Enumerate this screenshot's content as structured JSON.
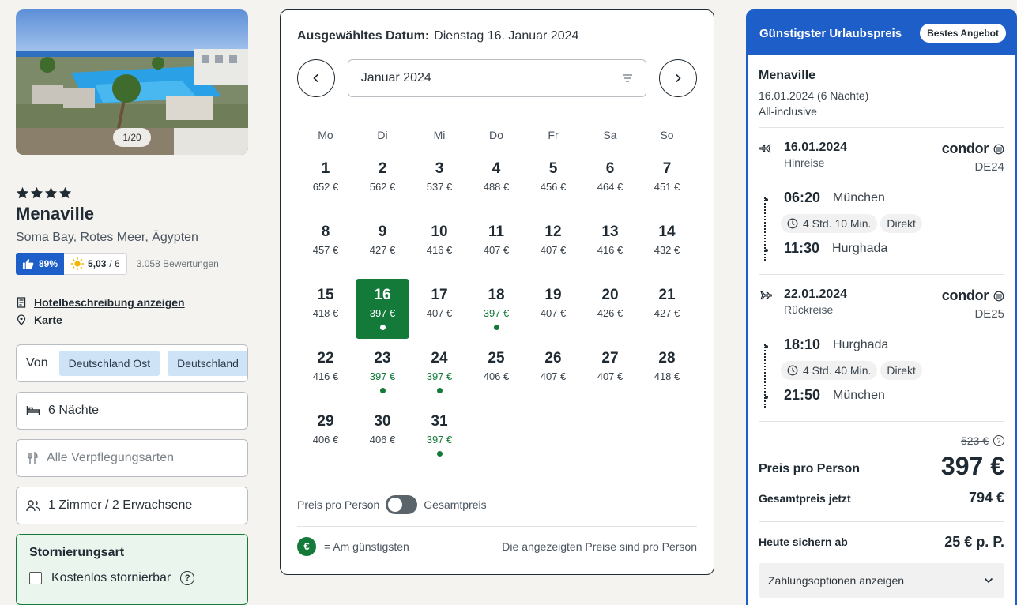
{
  "gallery": {
    "counter": "1/20"
  },
  "hotel": {
    "stars": 4,
    "name": "Menaville",
    "location": "Soma Bay, Rotes Meer, Ägypten",
    "recommendation": "89%",
    "score": "5,03",
    "score_max": "/ 6",
    "review_count": "3.058 Bewertungen",
    "description_link": "Hotelbeschreibung anzeigen",
    "map_link": "Karte"
  },
  "filters": {
    "departure_label": "Von",
    "departure_chips": [
      "Deutschland Ost",
      "Deutschland"
    ],
    "duration": "6 Nächte",
    "board_placeholder": "Alle Verpflegungsarten",
    "rooms": "1 Zimmer / 2 Erwachsene",
    "cancellation_title": "Stornierungsart",
    "cancellation_option": "Kostenlos stornierbar",
    "help_glyph": "?"
  },
  "calendar": {
    "selected_label": "Ausgewähltes Datum:",
    "selected_value": "Dienstag 16. Januar 2024",
    "month": "Januar 2024",
    "weekdays": [
      "Mo",
      "Di",
      "Mi",
      "Do",
      "Fr",
      "Sa",
      "So"
    ],
    "days": [
      {
        "day": "1",
        "price": "652 €",
        "cheap": false
      },
      {
        "day": "2",
        "price": "562 €",
        "cheap": false
      },
      {
        "day": "3",
        "price": "537 €",
        "cheap": false
      },
      {
        "day": "4",
        "price": "488 €",
        "cheap": false
      },
      {
        "day": "5",
        "price": "456 €",
        "cheap": false
      },
      {
        "day": "6",
        "price": "464 €",
        "cheap": false
      },
      {
        "day": "7",
        "price": "451 €",
        "cheap": false
      },
      {
        "day": "8",
        "price": "457 €",
        "cheap": false
      },
      {
        "day": "9",
        "price": "427 €",
        "cheap": false
      },
      {
        "day": "10",
        "price": "416 €",
        "cheap": false
      },
      {
        "day": "11",
        "price": "407 €",
        "cheap": false
      },
      {
        "day": "12",
        "price": "407 €",
        "cheap": false
      },
      {
        "day": "13",
        "price": "416 €",
        "cheap": false
      },
      {
        "day": "14",
        "price": "432 €",
        "cheap": false
      },
      {
        "day": "15",
        "price": "418 €",
        "cheap": false
      },
      {
        "day": "16",
        "price": "397 €",
        "cheap": true,
        "selected": true
      },
      {
        "day": "17",
        "price": "407 €",
        "cheap": false
      },
      {
        "day": "18",
        "price": "397 €",
        "cheap": true
      },
      {
        "day": "19",
        "price": "407 €",
        "cheap": false
      },
      {
        "day": "20",
        "price": "426 €",
        "cheap": false
      },
      {
        "day": "21",
        "price": "427 €",
        "cheap": false
      },
      {
        "day": "22",
        "price": "416 €",
        "cheap": false
      },
      {
        "day": "23",
        "price": "397 €",
        "cheap": true
      },
      {
        "day": "24",
        "price": "397 €",
        "cheap": true
      },
      {
        "day": "25",
        "price": "406 €",
        "cheap": false
      },
      {
        "day": "26",
        "price": "407 €",
        "cheap": false
      },
      {
        "day": "27",
        "price": "407 €",
        "cheap": false
      },
      {
        "day": "28",
        "price": "418 €",
        "cheap": false
      },
      {
        "day": "29",
        "price": "406 €",
        "cheap": false
      },
      {
        "day": "30",
        "price": "406 €",
        "cheap": false
      },
      {
        "day": "31",
        "price": "397 €",
        "cheap": true
      }
    ],
    "toggle_left": "Preis pro Person",
    "toggle_right": "Gesamtpreis",
    "legend_symbol": "€",
    "legend_text": "= Am günstigsten",
    "footnote": "Die angezeigten Preise sind pro Person",
    "accent_color": "#137a3a"
  },
  "offer": {
    "header_title": "Günstigster Urlaubspreis",
    "badge": "Bestes Angebot",
    "hotel_name": "Menaville",
    "dates": "16.01.2024 (6 Nächte)",
    "board": "All-inclusive",
    "outbound": {
      "date": "16.01.2024",
      "direction": "Hinreise",
      "airline": "condor",
      "flight_no": "DE24",
      "dep_time": "06:20",
      "dep_place": "München",
      "duration": "4 Std. 10 Min.",
      "type": "Direkt",
      "arr_time": "11:30",
      "arr_place": "Hurghada"
    },
    "return": {
      "date": "22.01.2024",
      "direction": "Rückreise",
      "airline": "condor",
      "flight_no": "DE25",
      "dep_time": "18:10",
      "dep_place": "Hurghada",
      "duration": "4 Std. 40 Min.",
      "type": "Direkt",
      "arr_time": "21:50",
      "arr_place": "München"
    },
    "old_price": "523 €",
    "price_label": "Preis pro Person",
    "price": "397 €",
    "total_label": "Gesamtpreis jetzt",
    "total": "794 €",
    "secure_label": "Heute sichern ab",
    "secure_value": "25 € p. P.",
    "payment_options": "Zahlungsoptionen anzeigen",
    "brand_color": "#1d5ec9"
  }
}
